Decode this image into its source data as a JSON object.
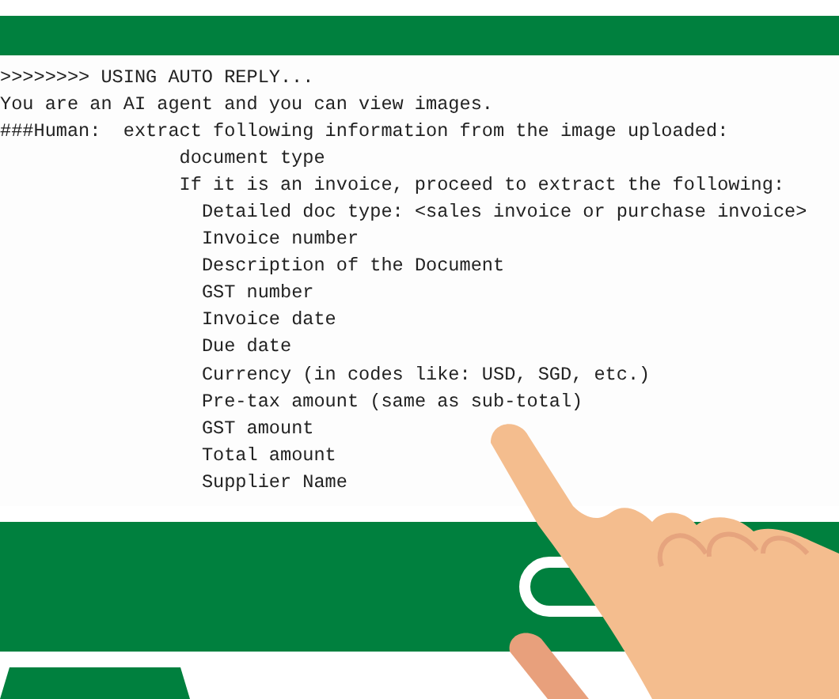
{
  "console": {
    "lines": [
      {
        "text": ">>>>>>>> USING AUTO REPLY..."
      },
      {
        "text": "You are an AI agent and you can view images."
      },
      {
        "text": "###Human:  extract following information from the image uploaded:",
        "children": [
          {
            "text": "document type"
          },
          {
            "text": "If it is an invoice, proceed to extract the following:",
            "children": [
              {
                "text": "Detailed doc type: <sales invoice or purchase invoice>"
              },
              {
                "text": "Invoice number"
              },
              {
                "text": "Description of the Document"
              },
              {
                "text": "GST number"
              },
              {
                "text": "Invoice date"
              },
              {
                "text": "Due date"
              },
              {
                "text": "Currency (in codes like: USD, SGD, etc.)"
              },
              {
                "text": "Pre-tax amount (same as sub-total)"
              },
              {
                "text": "GST amount"
              },
              {
                "text": "Total amount"
              },
              {
                "text": "Supplier Name"
              }
            ]
          }
        ]
      }
    ]
  }
}
